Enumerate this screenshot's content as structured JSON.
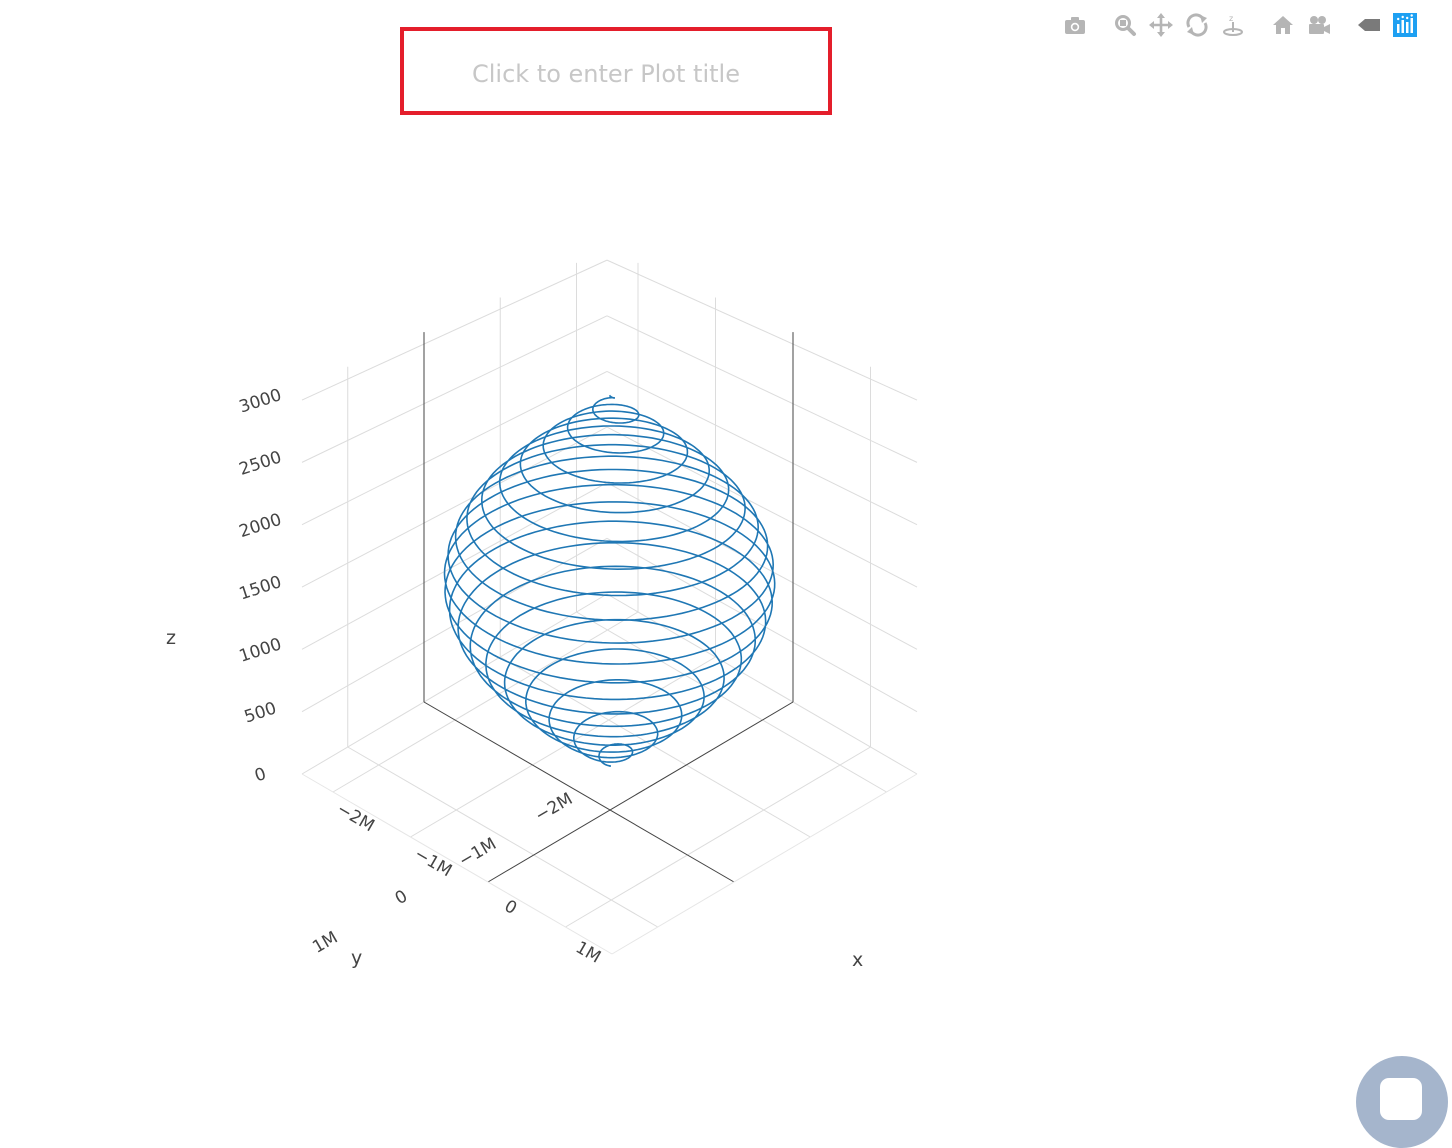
{
  "plot": {
    "title_placeholder": "Click to enter Plot title"
  },
  "modebar": {
    "buttons": [
      {
        "name": "camera-icon"
      },
      {
        "name": "zoom-icon"
      },
      {
        "name": "pan-icon"
      },
      {
        "name": "orbit-rotation-icon"
      },
      {
        "name": "turntable-rotation-icon"
      },
      {
        "name": "home-icon"
      },
      {
        "name": "camera-view-icon"
      },
      {
        "name": "hover-toggle-icon"
      },
      {
        "name": "plotly-logo-icon"
      }
    ],
    "accent_color": "#1ea0f2"
  },
  "chart_data": {
    "type": "line3d",
    "title": "",
    "series": [
      {
        "name": "",
        "shape": "spiral on spheroid surface",
        "turns": 20,
        "color": "#1f77b4"
      }
    ],
    "x": {
      "label": "x",
      "ticks": [
        "−2M",
        "−1M",
        "0",
        "1M"
      ],
      "range": [
        -2400000,
        1600000
      ]
    },
    "y": {
      "label": "y",
      "ticks": [
        "−2M",
        "−1M",
        "0",
        "1M"
      ],
      "range": [
        -2400000,
        1600000
      ]
    },
    "z": {
      "label": "z",
      "ticks": [
        "0",
        "500",
        "1000",
        "1500",
        "2000",
        "2500",
        "3000"
      ],
      "range": [
        0,
        3100
      ]
    },
    "grid": true
  }
}
